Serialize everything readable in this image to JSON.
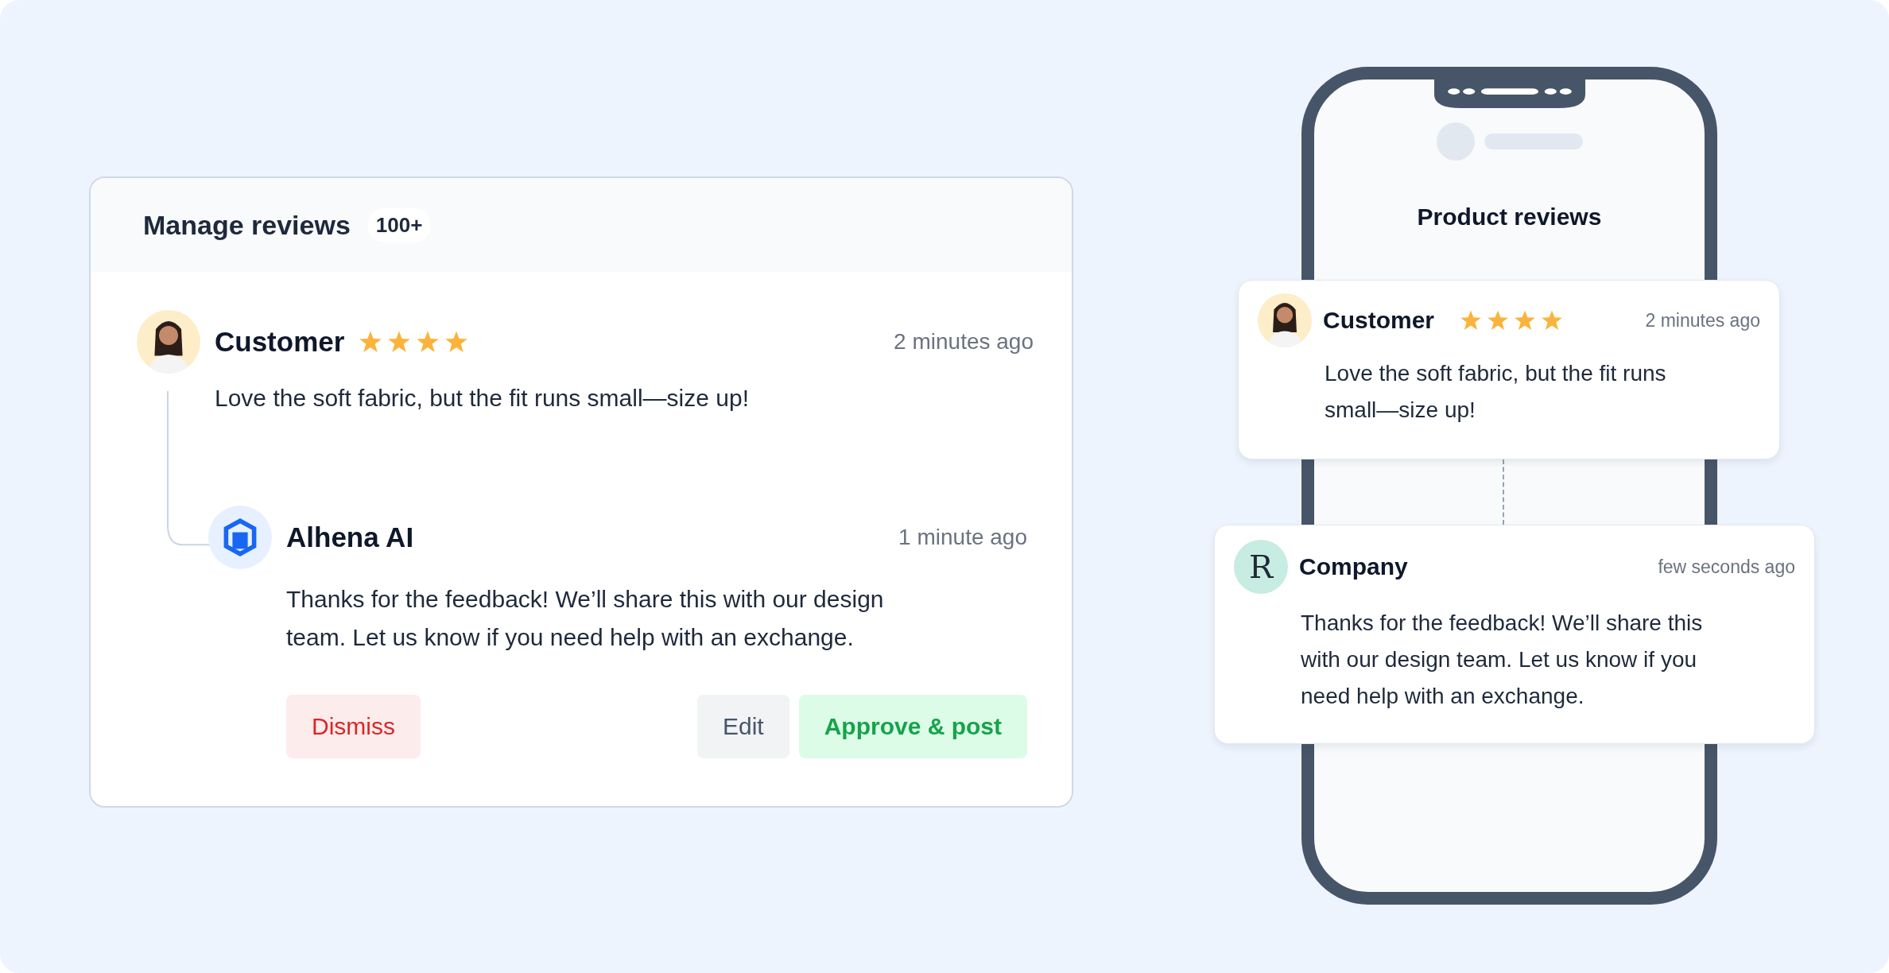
{
  "manage_card": {
    "title": "Manage reviews",
    "count": "100+",
    "review": {
      "author": "Customer",
      "stars": 4,
      "time": "2 minutes ago",
      "text": "Love the soft fabric, but the fit runs small—size up!"
    },
    "reply": {
      "author": "Alhena AI",
      "time": "1 minute ago",
      "text": "Thanks for the feedback! We’ll share this with our design team. Let us know if you need help with an exchange."
    },
    "buttons": [
      {
        "label": "Dismiss",
        "kind": "danger"
      },
      {
        "label": "Edit",
        "kind": "neutral"
      },
      {
        "label": "Approve & post",
        "kind": "primary"
      }
    ]
  },
  "phone": {
    "title": "Product reviews",
    "review": {
      "author": "Customer",
      "stars": 4,
      "time": "2 minutes ago",
      "text": "Love the soft fabric, but the fit runs small—size up!"
    },
    "reply": {
      "author": "Company",
      "logo": "R",
      "time": "few seconds ago",
      "text": "Thanks for the feedback! We’ll share this with our design team. Let us know if you need help with an exchange."
    }
  }
}
